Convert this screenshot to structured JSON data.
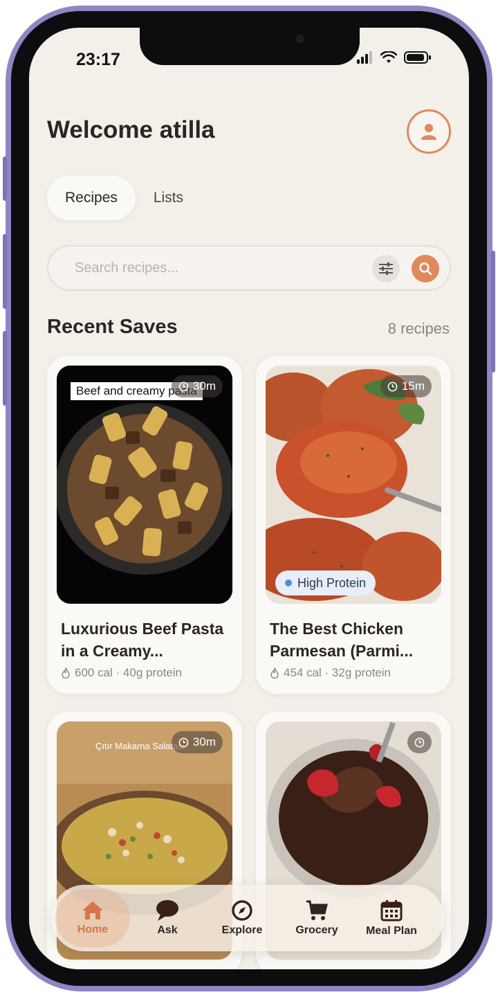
{
  "status_bar": {
    "time": "23:17"
  },
  "header": {
    "title": "Welcome atilla"
  },
  "tabs": [
    {
      "label": "Recipes",
      "active": true
    },
    {
      "label": "Lists",
      "active": false
    }
  ],
  "search": {
    "placeholder": "Search recipes...",
    "value": ""
  },
  "section": {
    "title": "Recent Saves",
    "count": "8 recipes"
  },
  "recipes": [
    {
      "name": "Luxurious Beef Pasta in a Creamy...",
      "time": "30m",
      "meta": "600 cal · 40g protein",
      "caption": "Beef and creamy pasta",
      "tag": ""
    },
    {
      "name": "The Best Chicken Parmesan (Parmi...",
      "time": "15m",
      "meta": "454 cal · 32g protein",
      "caption": "",
      "tag": "High Protein"
    },
    {
      "name": "",
      "time": "30m",
      "meta": "",
      "caption": "Çıtır Makarna Salatası",
      "tag": ""
    },
    {
      "name": "",
      "time": "",
      "meta": "",
      "caption": "",
      "tag": ""
    }
  ],
  "nav": [
    {
      "label": "Home",
      "icon": "home-icon",
      "active": true
    },
    {
      "label": "Ask",
      "icon": "chat-bubble-icon",
      "active": false
    },
    {
      "label": "Explore",
      "icon": "compass-icon",
      "active": false
    },
    {
      "label": "Grocery",
      "icon": "cart-icon",
      "active": false
    },
    {
      "label": "Meal Plan",
      "icon": "calendar-icon",
      "active": false
    }
  ],
  "colors": {
    "accent": "#e0895c",
    "background": "#f3efe9",
    "tag_bg": "#e7eef8"
  }
}
